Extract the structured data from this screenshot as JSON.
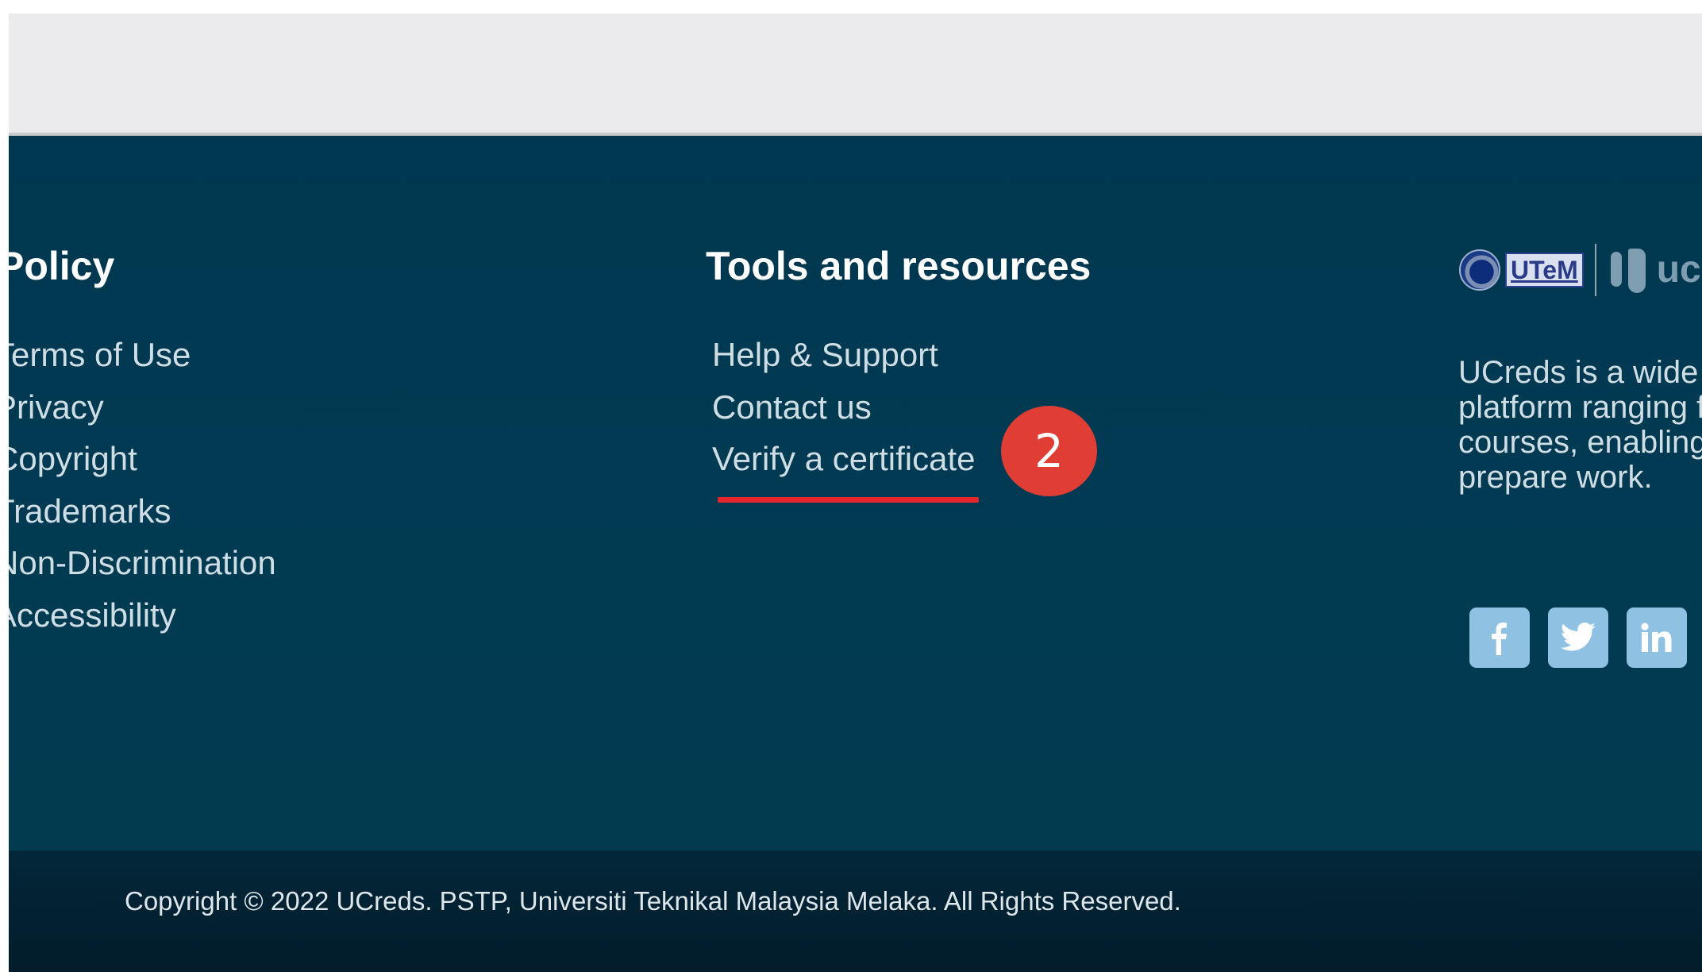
{
  "colors": {
    "top_band": "#ebebee",
    "footer_background": "#003750",
    "footer_bottom_background": "#021c2a",
    "heading_text": "#ffffff",
    "link_text": "#cfdde4",
    "highlight_red": "#e4262c",
    "badge_red": "#e03d35",
    "social_button": "#8fc1e3"
  },
  "footer": {
    "policy": {
      "heading": "Policy",
      "links": [
        "Terms of Use",
        "Privacy",
        "Copyright",
        "Trademarks",
        "Non-Discrimination",
        "Accessibility"
      ]
    },
    "tools": {
      "heading": "Tools and resources",
      "links": [
        "Help & Support",
        "Contact us",
        "Verify a certificate"
      ]
    },
    "about": {
      "logo_utem_text": "UTeM",
      "logo_ucreds_text": "ucreds",
      "description": "UCreds is a wide learning platform ranging from up courses, enabling degree or prepare work."
    },
    "social": [
      {
        "name": "facebook",
        "icon": "facebook-icon"
      },
      {
        "name": "twitter",
        "icon": "twitter-icon"
      },
      {
        "name": "linkedin",
        "icon": "linkedin-icon"
      }
    ]
  },
  "annotation": {
    "step_number": "2",
    "highlighted_link": "Verify a certificate"
  },
  "bottom_bar": {
    "copyright": "Copyright © 2022 UCreds. PSTP, Universiti Teknikal Malaysia Melaka. All Rights Reserved."
  }
}
